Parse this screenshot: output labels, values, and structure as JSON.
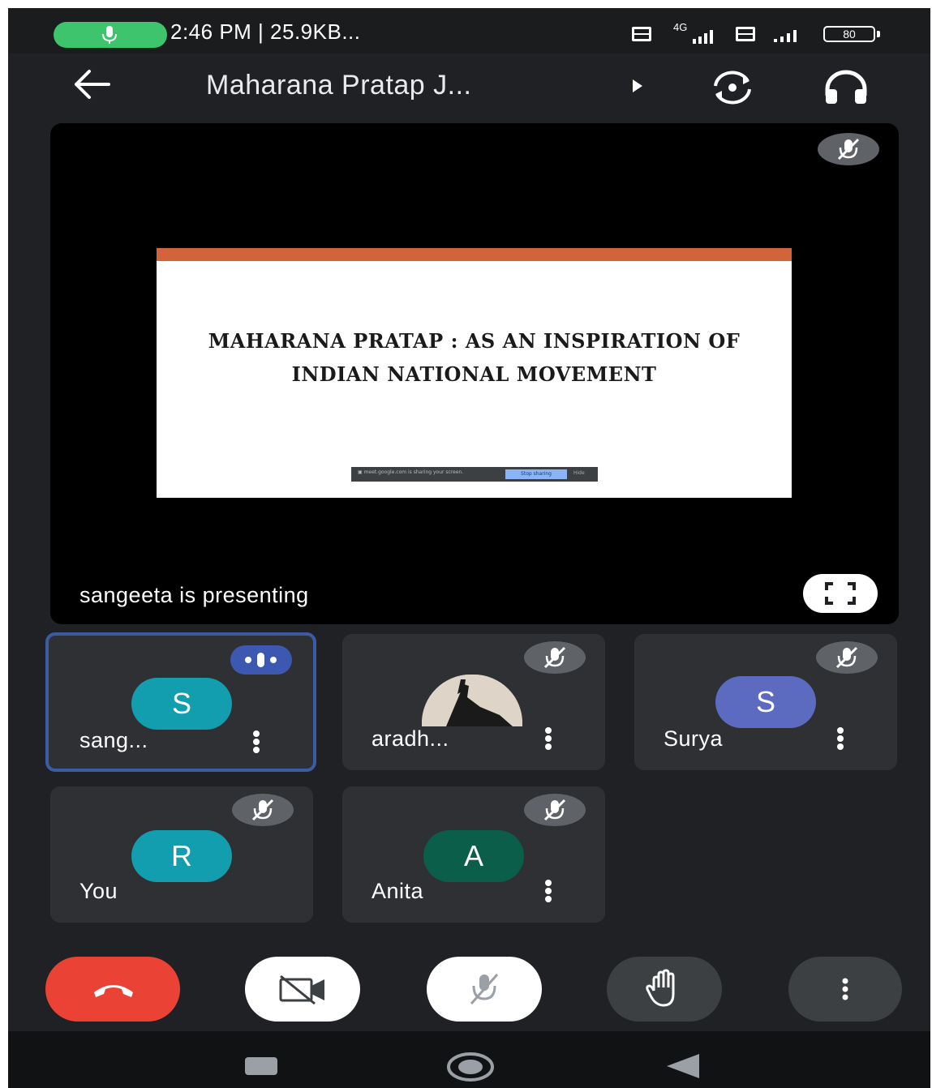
{
  "status_bar": {
    "time_info": "2:46 PM | 25.9KB...",
    "network_1": "4G",
    "battery": "80",
    "colors": {
      "mic_pill": "#3ec46d"
    }
  },
  "app_bar": {
    "title": "Maharana Pratap J...",
    "icons": [
      "back-arrow-icon",
      "caret-right-icon",
      "switch-camera-icon",
      "headphones-icon"
    ]
  },
  "presentation": {
    "slide_title": "MAHARANA PRATAP : AS AN INSPIRATION OF INDIAN NATIONAL MOVEMENT",
    "accent_color": "#d2643c",
    "presenter_text": "sangeeta is presenting"
  },
  "participants": [
    {
      "name": "sang...",
      "initial": "S",
      "avatar_color": "#129eaf",
      "speaking": true,
      "more": true
    },
    {
      "name": "aradh...",
      "initial": "",
      "avatar_color": "#d9cfc3",
      "muted": true,
      "more": true,
      "photo": true
    },
    {
      "name": "Surya",
      "initial": "S",
      "avatar_color": "#5c6bc0",
      "muted": true,
      "more": true
    },
    {
      "name": "You",
      "initial": "R",
      "avatar_color": "#129eaf",
      "muted": true,
      "more": false
    },
    {
      "name": "Anita",
      "initial": "A",
      "avatar_color": "#0b5e4a",
      "muted": true,
      "more": true
    }
  ],
  "controls": {
    "end_call_color": "#ea4335",
    "items": [
      "end-call-icon",
      "camera-off-icon",
      "mic-off-icon",
      "raise-hand-icon",
      "more-options-icon"
    ]
  }
}
